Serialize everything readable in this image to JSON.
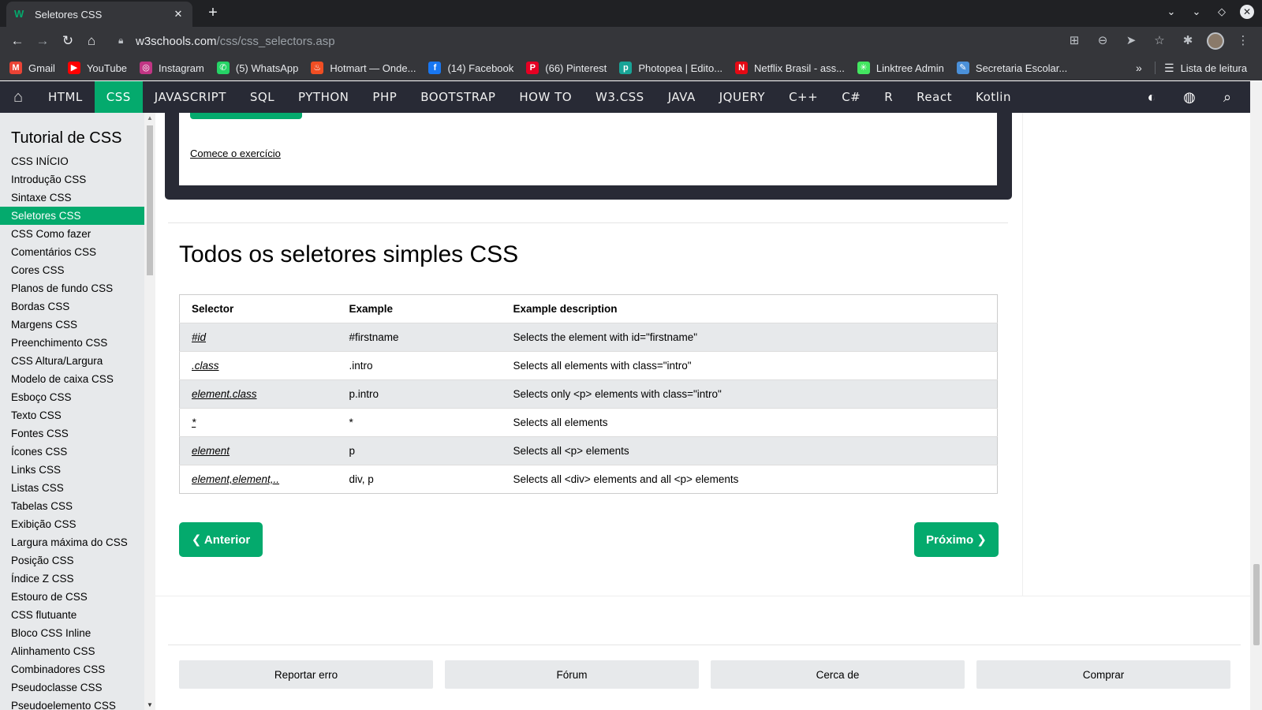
{
  "browser": {
    "tab_title": "Seletores CSS",
    "tab_favicon": "w3schools-logo",
    "new_tab_label": "+",
    "url_host": "w3schools.com",
    "url_path": "/css/css_selectors.asp",
    "reading_list_label": "Lista de leitura",
    "more_bookmarks": "»"
  },
  "bookmarks": [
    {
      "label": "Gmail",
      "icon": "gmail-icon",
      "color": "#ea4335",
      "glyph": "M"
    },
    {
      "label": "YouTube",
      "icon": "youtube-icon",
      "color": "#ff0000",
      "glyph": "▶"
    },
    {
      "label": "Instagram",
      "icon": "instagram-icon",
      "color": "#c13584",
      "glyph": "◎"
    },
    {
      "label": "(5) WhatsApp",
      "icon": "whatsapp-icon",
      "color": "#25d366",
      "glyph": "✆"
    },
    {
      "label": "Hotmart — Onde...",
      "icon": "hotmart-icon",
      "color": "#f04e23",
      "glyph": "♨"
    },
    {
      "label": "(14) Facebook",
      "icon": "facebook-icon",
      "color": "#1877f2",
      "glyph": "f"
    },
    {
      "label": "(66) Pinterest",
      "icon": "pinterest-icon",
      "color": "#e60023",
      "glyph": "P"
    },
    {
      "label": "Photopea | Edito...",
      "icon": "photopea-icon",
      "color": "#18a497",
      "glyph": "p"
    },
    {
      "label": "Netflix Brasil - ass...",
      "icon": "netflix-icon",
      "color": "#e50914",
      "glyph": "N"
    },
    {
      "label": "Linktree Admin",
      "icon": "linktree-icon",
      "color": "#43e660",
      "glyph": "✳"
    },
    {
      "label": "Secretaria Escolar...",
      "icon": "secretaria-icon",
      "color": "#4a90d9",
      "glyph": "✎"
    }
  ],
  "topnav": {
    "items": [
      "HTML",
      "CSS",
      "JAVASCRIPT",
      "SQL",
      "PYTHON",
      "PHP",
      "BOOTSTRAP",
      "HOW TO",
      "W3.CSS",
      "JAVA",
      "JQUERY",
      "C++",
      "C#",
      "R",
      "React",
      "Kotlin"
    ],
    "active": "CSS",
    "accent": "#04aa6d",
    "background": "#282a35"
  },
  "sidebar": {
    "title": "Tutorial de CSS",
    "active": "Seletores CSS",
    "items": [
      "CSS INÍCIO",
      "Introdução CSS",
      "Sintaxe CSS",
      "Seletores CSS",
      "CSS Como fazer",
      "Comentários CSS",
      "Cores CSS",
      "Planos de fundo CSS",
      "Bordas CSS",
      "Margens CSS",
      "Preenchimento CSS",
      "CSS Altura/Largura",
      "Modelo de caixa CSS",
      "Esboço CSS",
      "Texto CSS",
      "Fontes CSS",
      "Ícones CSS",
      "Links CSS",
      "Listas CSS",
      "Tabelas CSS",
      "Exibição CSS",
      "Largura máxima do CSS",
      "Posição CSS",
      "Índice Z CSS",
      "Estouro de CSS",
      "CSS flutuante",
      "Bloco CSS Inline",
      "Alinhamento CSS",
      "Combinadores CSS",
      "Pseudoclasse CSS",
      "Pseudoelemento CSS"
    ]
  },
  "main": {
    "exercise_link": "Comece o exercício",
    "heading": "Todos os seletores simples CSS",
    "table": {
      "headers": [
        "Selector",
        "Example",
        "Example description"
      ],
      "rows": [
        [
          "#id",
          "#firstname",
          "Selects the element with id=\"firstname\""
        ],
        [
          ".class",
          ".intro",
          "Selects all elements with class=\"intro\""
        ],
        [
          "element.class",
          "p.intro",
          "Selects only <p> elements with class=\"intro\""
        ],
        [
          "*",
          "*",
          "Selects all elements"
        ],
        [
          "element",
          "p",
          "Selects all <p> elements"
        ],
        [
          "element,element,..",
          "div, p",
          "Selects all <div> elements and all <p> elements"
        ]
      ]
    },
    "prev_label": "❮ Anterior",
    "next_label": "Próximo ❯"
  },
  "footer": {
    "buttons": [
      "Reportar erro",
      "Fórum",
      "Cerca de",
      "Comprar"
    ]
  }
}
